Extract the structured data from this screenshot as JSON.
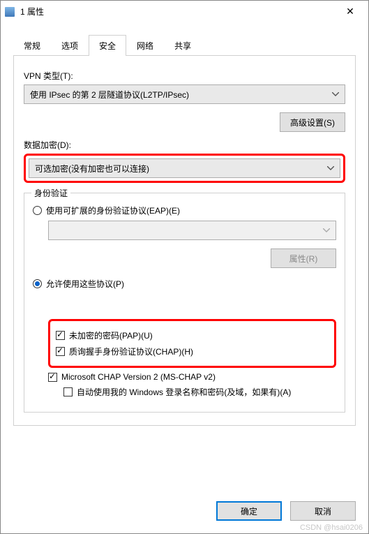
{
  "window": {
    "title": "1 属性"
  },
  "tabs": {
    "items": [
      "常规",
      "选项",
      "安全",
      "网络",
      "共享"
    ],
    "active_index": 2
  },
  "security": {
    "vpn_type_label": "VPN 类型(T):",
    "vpn_type_value": "使用 IPsec 的第 2 层隧道协议(L2TP/IPsec)",
    "advanced_button": "高级设置(S)",
    "encryption_label": "数据加密(D):",
    "encryption_value": "可选加密(没有加密也可以连接)",
    "auth_group_title": "身份验证",
    "eap_radio": "使用可扩展的身份验证协议(EAP)(E)",
    "eap_combo_value": "",
    "eap_properties_button": "属性(R)",
    "allow_protocols_radio": "允许使用这些协议(P)",
    "pap_check": "未加密的密码(PAP)(U)",
    "chap_check": "质询握手身份验证协议(CHAP)(H)",
    "mschap_check": "Microsoft CHAP Version 2 (MS-CHAP v2)",
    "mschap_auto_check": "自动使用我的 Windows 登录名称和密码(及域，如果有)(A)"
  },
  "buttons": {
    "ok": "确定",
    "cancel": "取消"
  },
  "watermark": "CSDN @hsai0206",
  "annotations": {
    "highlight_encryption": true,
    "highlight_pap_chap": true
  }
}
